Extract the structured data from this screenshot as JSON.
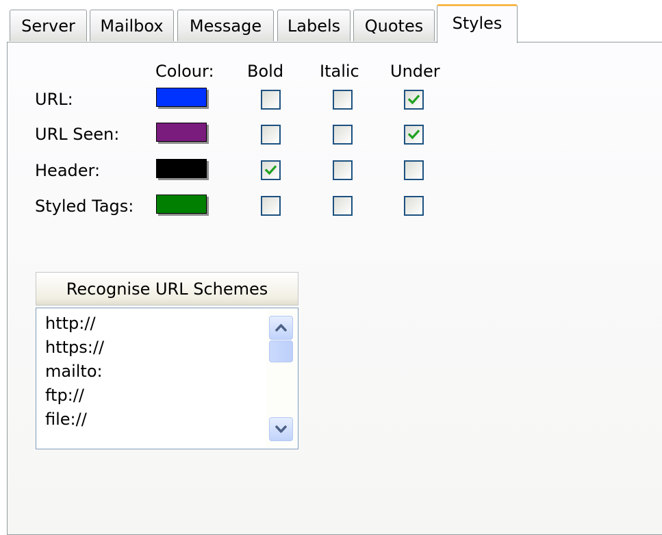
{
  "tabs": [
    "Server",
    "Mailbox",
    "Message",
    "Labels",
    "Quotes",
    "Styles"
  ],
  "active_tab": "Styles",
  "columns": {
    "colour": "Colour:",
    "bold": "Bold",
    "italic": "Italic",
    "under": "Under"
  },
  "styles": [
    {
      "label": "URL:",
      "color": "#0033ff",
      "bold": false,
      "italic": false,
      "under": true
    },
    {
      "label": "URL Seen:",
      "color": "#7a1b7e",
      "bold": false,
      "italic": false,
      "under": true
    },
    {
      "label": "Header:",
      "color": "#000000",
      "bold": true,
      "italic": false,
      "under": false
    },
    {
      "label": "Styled Tags:",
      "color": "#007f00",
      "bold": false,
      "italic": false,
      "under": false
    }
  ],
  "check_color": "#21a121",
  "schemes": {
    "header": "Recognise URL Schemes",
    "items": [
      "http://",
      "https://",
      "mailto:",
      "ftp://",
      "file://"
    ],
    "scroll_up_icon": "chevron-up-icon",
    "scroll_down_icon": "chevron-down-icon"
  }
}
